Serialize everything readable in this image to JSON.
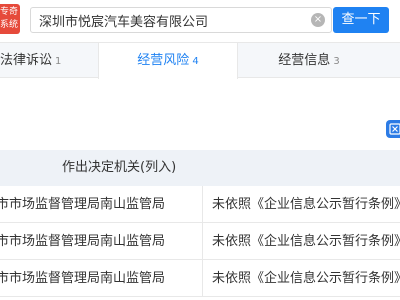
{
  "logo": {
    "line1": "专奇",
    "line2": "系统"
  },
  "search": {
    "value": "深圳市悦宸汽车美容有限公司",
    "button_label": "查一下",
    "clear_glyph": "×"
  },
  "tabs": [
    {
      "label": "法律诉讼",
      "count": "1",
      "active": false
    },
    {
      "label": "经营风险",
      "count": "4",
      "active": true
    },
    {
      "label": "经营信息",
      "count": "3",
      "active": false
    }
  ],
  "table": {
    "header": "作出决定机关(列入)",
    "rows": [
      {
        "authority": "市市场监督管理局南山监管局",
        "reason": "未依照《企业信息公示暂行条例》第八"
      },
      {
        "authority": "市市场监督管理局南山监管局",
        "reason": "未依照《企业信息公示暂行条例》第八"
      },
      {
        "authority": "市市场监督管理局南山监管局",
        "reason": "未依照《企业信息公示暂行条例》第八"
      }
    ]
  },
  "icons": {
    "export": "export-excel-icon",
    "clear": "clear-icon"
  },
  "colors": {
    "accent": "#1f82f2",
    "logo": "#e64a3b",
    "header_bg": "#eef2f7",
    "tab_bg": "#f5f7fa"
  }
}
